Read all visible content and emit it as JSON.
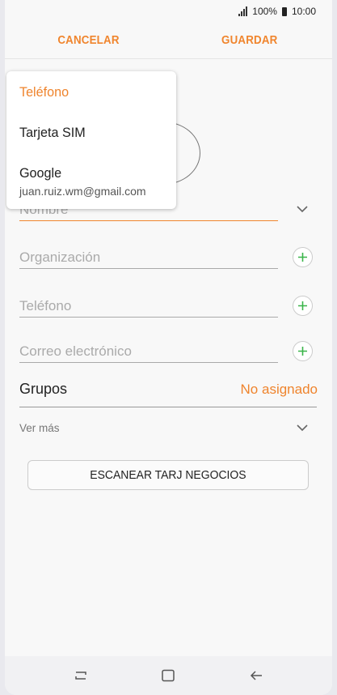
{
  "status": {
    "battery": "100%",
    "time": "10:00"
  },
  "header": {
    "cancel_label": "CANCELAR",
    "save_label": "GUARDAR"
  },
  "storage_menu": {
    "options": [
      {
        "label": "Teléfono",
        "selected": true
      },
      {
        "label": "Tarjeta SIM",
        "selected": false
      },
      {
        "label": "Google",
        "account": "juan.ruiz.wm@gmail.com",
        "selected": false
      }
    ]
  },
  "form": {
    "name_placeholder": "Nombre",
    "organization_placeholder": "Organización",
    "phone_placeholder": "Teléfono",
    "email_placeholder": "Correo electrónico",
    "groups_label": "Grupos",
    "groups_value": "No asignado",
    "more_label": "Ver más",
    "scan_button_label": "ESCANEAR TARJ NEGOCIOS"
  },
  "colors": {
    "accent": "#f0852d",
    "plus": "#3ab54a"
  }
}
